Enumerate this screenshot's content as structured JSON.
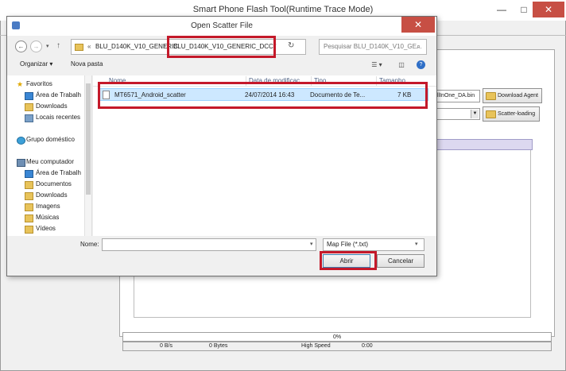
{
  "app": {
    "title": "Smart Phone Flash Tool(Runtime Trace Mode)",
    "minimize_glyph": "—",
    "maximize_glyph": "□",
    "close_glyph": "✕",
    "da_field_value": "llInOne_DA.bin",
    "download_agent_label": "Download Agent",
    "scatter_loading_label": "Scatter-loading",
    "progress_text": "0%",
    "status": {
      "speed": "0 B/s",
      "bytes": "0 Bytes",
      "usb": "High Speed",
      "time": "0:00"
    }
  },
  "dialog": {
    "title": "Open Scatter File",
    "close_glyph": "✕",
    "nav": {
      "back_glyph": "←",
      "forward_glyph": "→",
      "recent_glyph": "▾",
      "up_glyph": "↑"
    },
    "address": {
      "overflow": "«",
      "segment1": "BLU_D140K_V10_GENERIC",
      "separator": "›",
      "segment2": "BLU_D140K_V10_GENERIC_DCC",
      "dropdown_glyph": "▾",
      "refresh_glyph": "↻"
    },
    "search_placeholder": "Pesquisar BLU_D140K_V10_GE...",
    "search_glyph": "⌕",
    "toolbar": {
      "organize": "Organizar ▾",
      "new_folder": "Nova pasta",
      "view_glyph": "☰ ▾",
      "preview_glyph": "◫",
      "help_glyph": "?"
    },
    "nav_pane": [
      {
        "label": "Favoritos",
        "icon": "star-icon"
      },
      {
        "label": "Área de Trabalh",
        "icon": "desktop-icon"
      },
      {
        "label": "Downloads",
        "icon": "downloads-icon"
      },
      {
        "label": "Locais recentes",
        "icon": "recent-places-icon"
      },
      {
        "label": "Grupo doméstico",
        "icon": "homegroup-icon"
      },
      {
        "label": "Meu computador",
        "icon": "computer-icon"
      },
      {
        "label": "Área de Trabalh",
        "icon": "desktop-icon"
      },
      {
        "label": "Documentos",
        "icon": "documents-icon"
      },
      {
        "label": "Downloads",
        "icon": "downloads-icon"
      },
      {
        "label": "Imagens",
        "icon": "pictures-icon"
      },
      {
        "label": "Músicas",
        "icon": "music-icon"
      },
      {
        "label": "Vídeos",
        "icon": "videos-icon"
      }
    ],
    "columns": {
      "name": "Nome",
      "date": "Data de modificaç",
      "type": "Tipo",
      "size": "Tamanho"
    },
    "files": [
      {
        "name": "MT6571_Android_scatter",
        "date": "24/07/2014 16:43",
        "type": "Documento de Te...",
        "size": "7 KB"
      }
    ],
    "filename_label": "Nome:",
    "filename_value": "",
    "filetype": "Map File (*.txt)",
    "open_label": "Abrir",
    "cancel_label": "Cancelar"
  }
}
